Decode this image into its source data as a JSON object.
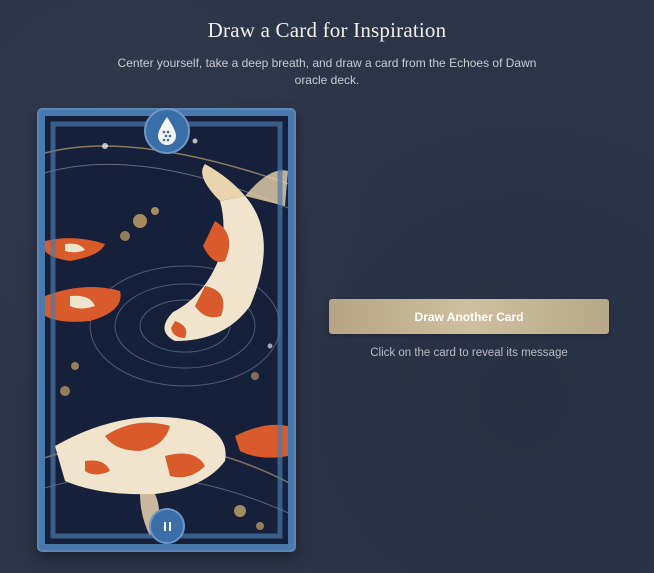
{
  "header": {
    "title": "Draw a Card for Inspiration",
    "subtitle": "Center yourself, take a deep breath, and draw a card from the Echoes of Dawn oracle deck."
  },
  "card": {
    "top_icon": "water-drop-icon",
    "bottom_icon": "pause-icon",
    "frame_color": "#4a79ad",
    "art_colors": {
      "water": "#16203a",
      "koi_orange": "#d95a2b",
      "koi_cream": "#f1e4cc",
      "gold": "#d9b77a"
    }
  },
  "actions": {
    "draw_button_label": "Draw Another Card",
    "hint": "Click on the card to reveal its message"
  },
  "colors": {
    "background": "#2c3448",
    "button": "#c2b391"
  }
}
